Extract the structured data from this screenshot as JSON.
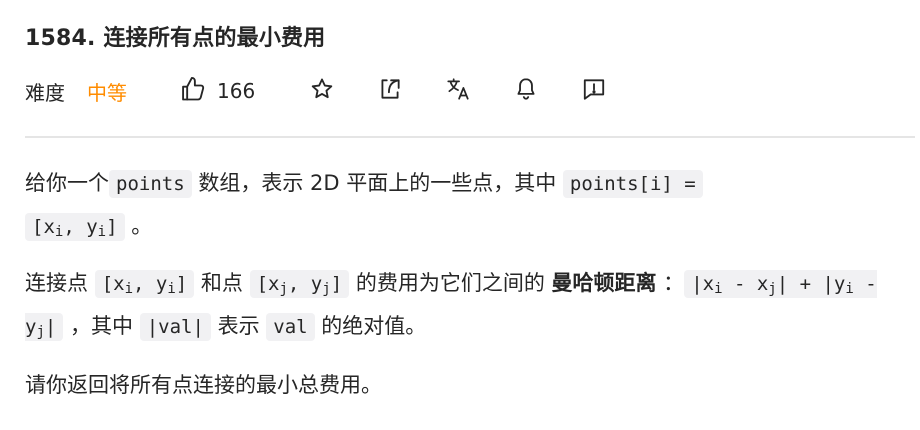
{
  "problem": {
    "title": "1584. 连接所有点的最小费用"
  },
  "meta": {
    "difficulty_label": "难度",
    "difficulty_value": "中等",
    "likes": "166"
  },
  "icons": {
    "like": "thumbs-up-icon",
    "favorite": "star-icon",
    "share": "share-icon",
    "translate": "translate-icon",
    "notify": "bell-icon",
    "feedback": "feedback-icon"
  },
  "colors": {
    "difficulty": "#ff8c00",
    "code_bg": "#f1f1f3",
    "text": "#262626"
  },
  "description": {
    "p1_a": "给你一个",
    "p1_code1": "points",
    "p1_b": " 数组，表示 2D 平面上的一些点，其中 ",
    "p1_code2": "points[i] =",
    "p1_code3_a": "[x",
    "p1_code3_sub1": "i",
    "p1_code3_b": ", y",
    "p1_code3_sub2": "i",
    "p1_code3_c": "]",
    "p1_end": " 。",
    "p2_a": "连接点 ",
    "p2_code1_a": "[x",
    "p2_code1_sub1": "i",
    "p2_code1_b": ", y",
    "p2_code1_sub2": "i",
    "p2_code1_c": "]",
    "p2_b": " 和点 ",
    "p2_code2_a": "[x",
    "p2_code2_sub1": "j",
    "p2_code2_b": ", y",
    "p2_code2_sub2": "j",
    "p2_code2_c": "]",
    "p2_c": " 的费用为它们之间的 ",
    "p2_bold": "曼哈顿距离",
    "p2_d": " ：",
    "p2_code3_a": "|x",
    "p2_code3_sub1": "i",
    "p2_code3_b": " - x",
    "p2_code3_sub2": "j",
    "p2_code3_c": "| + |y",
    "p2_code3_sub3": "i",
    "p2_code3_d": " - y",
    "p2_code3_sub4": "j",
    "p2_code3_e": "|",
    "p2_e": " ，其中 ",
    "p2_code4": "|val|",
    "p2_f": " 表示 ",
    "p2_code5": "val",
    "p2_g": " 的绝对值。",
    "p3": "请你返回将所有点连接的最小总费用。"
  }
}
